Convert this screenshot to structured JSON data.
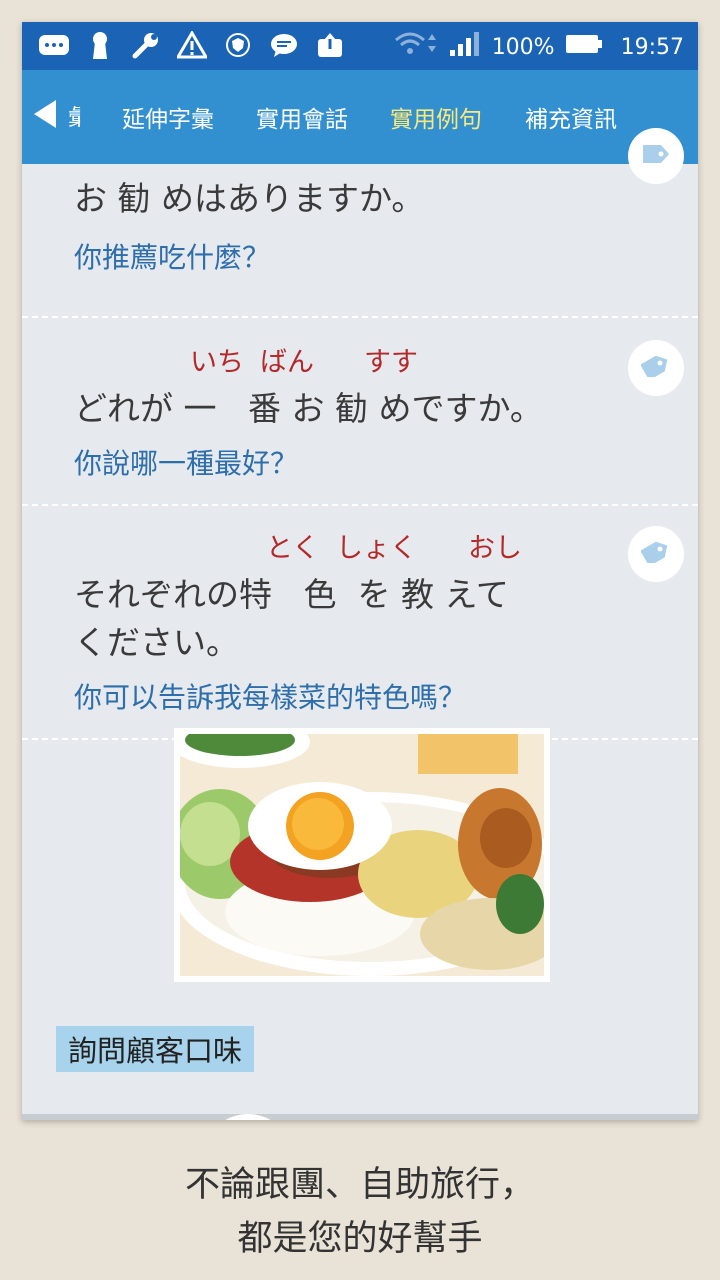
{
  "status_bar": {
    "battery_text": "100%",
    "time": "19:57",
    "left_icons": [
      "message-icon",
      "keyhole-icon",
      "wrench-icon",
      "warning-icon",
      "shield-icon",
      "chat-icon",
      "upload-icon"
    ]
  },
  "tabs": {
    "back_partial_label": "彙",
    "items": [
      {
        "label": "延伸字彙"
      },
      {
        "label": "實用會話"
      },
      {
        "label": "實用例句"
      },
      {
        "label": "補充資訊"
      }
    ],
    "active_index": 2,
    "active_color": "#fbe97a"
  },
  "sentences": [
    {
      "jp_parts": [
        "お",
        "勧",
        "めはありますか。"
      ],
      "zh": "你推薦吃什麼？"
    },
    {
      "jp_parts": [
        "どれが",
        "一",
        "番",
        "お",
        "勧",
        "めですか。"
      ],
      "ruby": [
        "いち",
        "ばん",
        "すす"
      ],
      "zh": "你說哪一種最好？"
    },
    {
      "jp_parts": [
        "それぞれの",
        "特",
        "色",
        "を",
        "教",
        "えて"
      ],
      "jp_line2": "ください。",
      "ruby": [
        "とく",
        "しょく",
        "おし"
      ],
      "zh": "你可以告訴我每樣菜的特色嗎？"
    }
  ],
  "section_label": "詢問顧客口味",
  "caption": {
    "line1": "不論跟團、自助旅行，",
    "line2": "都是您的好幫手"
  },
  "colors": {
    "status_bar": "#1a63b5",
    "tab_bar": "#3390d0",
    "ruby": "#b42a2a",
    "translation": "#2e6eab",
    "section_label_bg": "#a7d3ec"
  }
}
